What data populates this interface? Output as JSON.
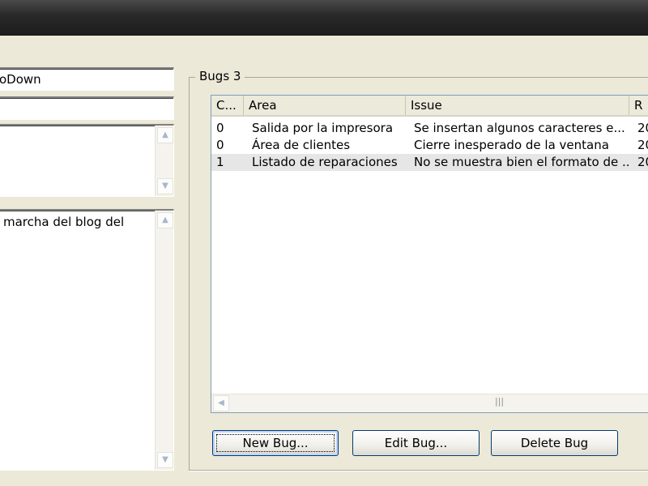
{
  "form": {
    "field1_value": "oDown",
    "field2_value": "",
    "field4_text": "marcha del blog del"
  },
  "bugs": {
    "title": "Bugs 3",
    "columns": [
      "C...",
      "Area",
      "Issue",
      "R"
    ],
    "rows": [
      {
        "c": "0",
        "area": "Salida por la impresora",
        "issue": "Se insertan algunos caracteres e...",
        "r": "20"
      },
      {
        "c": "0",
        "area": "Área de clientes",
        "issue": "Cierre inesperado de la ventana",
        "r": "20"
      },
      {
        "c": "1",
        "area": "Listado de reparaciones",
        "issue": "No se muestra bien el formato de ...",
        "r": "20"
      }
    ],
    "hscroll_grip": "|||"
  },
  "buttons": {
    "new_bug": "New Bug...",
    "edit_bug": "Edit Bug...",
    "delete_bug": "Delete Bug"
  },
  "icons": {
    "scroll_up": "up-arrow-icon",
    "scroll_down": "down-arrow-icon",
    "scroll_left": "left-arrow-icon"
  }
}
